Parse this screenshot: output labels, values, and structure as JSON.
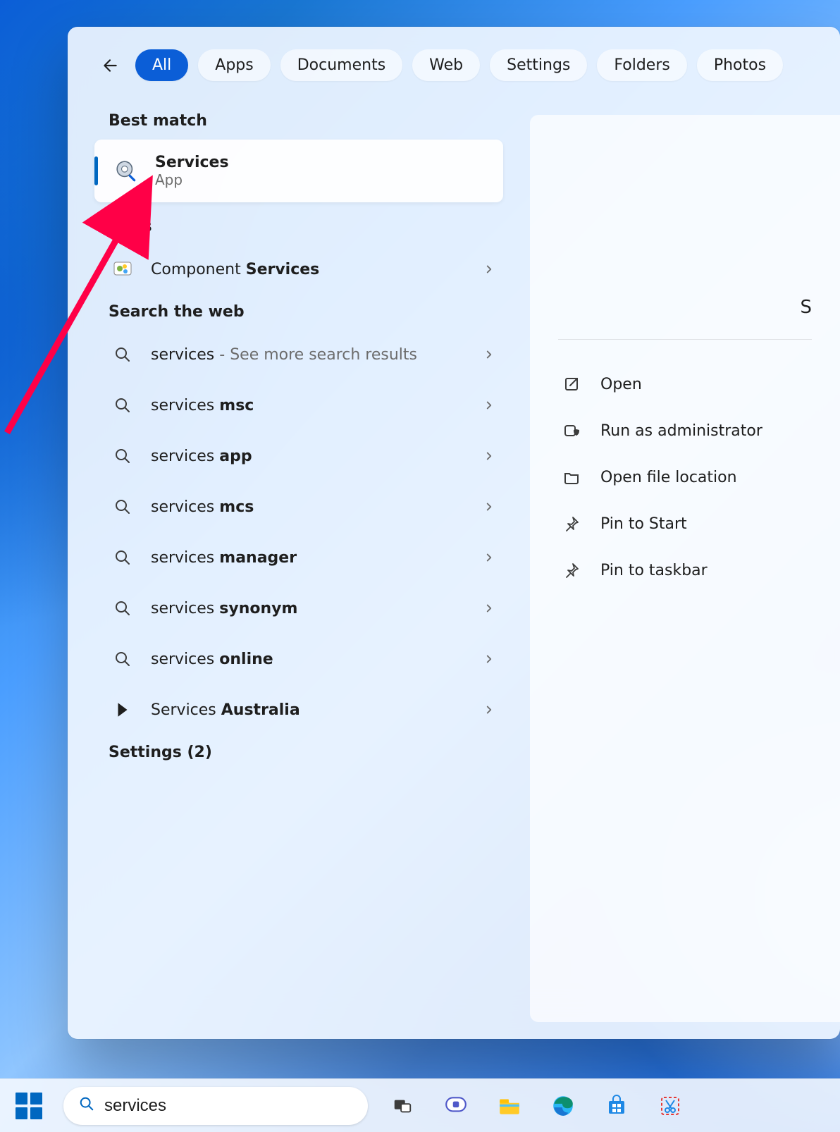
{
  "tabs": {
    "all": "All",
    "apps": "Apps",
    "documents": "Documents",
    "web": "Web",
    "settings": "Settings",
    "folders": "Folders",
    "photos": "Photos"
  },
  "sections": {
    "best": "Best match",
    "apps": "Apps",
    "web": "Search the web",
    "settings": "Settings (2)"
  },
  "best": {
    "title": "Services",
    "subtitle": "App"
  },
  "app_results": [
    {
      "prefix": "Component ",
      "bold": "Services"
    }
  ],
  "web_results": [
    {
      "text": "services",
      "suffix": " - See more search results",
      "bold": "",
      "icon": "search"
    },
    {
      "text": "services ",
      "bold": "msc",
      "suffix": "",
      "icon": "search"
    },
    {
      "text": "services ",
      "bold": "app",
      "suffix": "",
      "icon": "search"
    },
    {
      "text": "services ",
      "bold": "mcs",
      "suffix": "",
      "icon": "search"
    },
    {
      "text": "services ",
      "bold": "manager",
      "suffix": "",
      "icon": "search"
    },
    {
      "text": "services ",
      "bold": "synonym",
      "suffix": "",
      "icon": "search"
    },
    {
      "text": "services ",
      "bold": "online",
      "suffix": "",
      "icon": "search"
    },
    {
      "text": "Services ",
      "bold": "Australia",
      "suffix": "",
      "icon": "site"
    }
  ],
  "preview": {
    "title_fragment": "S",
    "actions": [
      {
        "icon": "open",
        "label": "Open"
      },
      {
        "icon": "shield",
        "label": "Run as administrator"
      },
      {
        "icon": "folder",
        "label": "Open file location"
      },
      {
        "icon": "pin",
        "label": "Pin to Start"
      },
      {
        "icon": "pin",
        "label": "Pin to taskbar"
      }
    ]
  },
  "search_value": "services"
}
